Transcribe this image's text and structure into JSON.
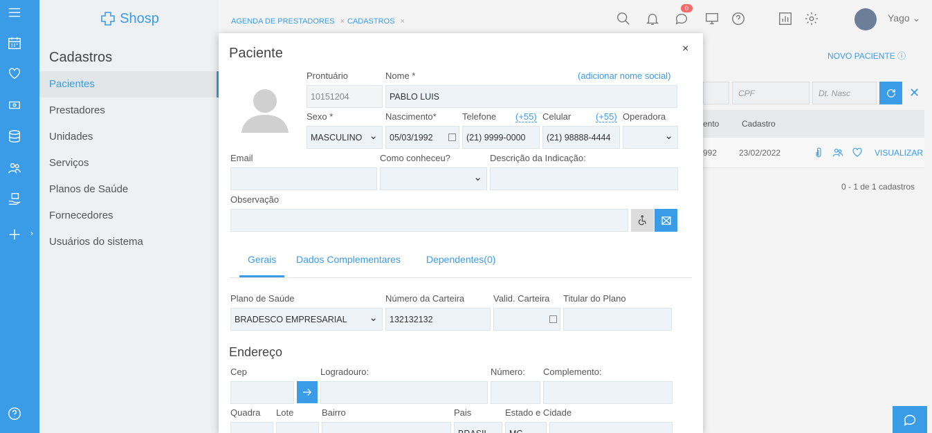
{
  "app": {
    "logo_text": "Shosp"
  },
  "sidebar": {
    "title": "Cadastros",
    "items": [
      {
        "label": "Pacientes"
      },
      {
        "label": "Prestadores"
      },
      {
        "label": "Unidades"
      },
      {
        "label": "Serviços"
      },
      {
        "label": "Planos de Saúde"
      },
      {
        "label": "Fornecedores"
      },
      {
        "label": "Usuários do sistema"
      }
    ]
  },
  "topbar": {
    "tabs": [
      {
        "label": "AGENDA DE PRESTADORES"
      },
      {
        "label": "CADASTROS"
      }
    ],
    "tab_close": "×",
    "notification_count": "0",
    "user_name": "Yago"
  },
  "background_page": {
    "novo_paciente": "NOVO PACIENTE",
    "filter_cpf_placeholder": "CPF",
    "filter_dtnasc_placeholder": "Dt. Nasc",
    "columns": [
      "ento",
      "Cadastro"
    ],
    "row": {
      "nascimento_partial": "992",
      "cadastro": "23/02/2022",
      "action": "VISUALIZAR"
    },
    "count_text": "0 - 1 de 1 cadastros"
  },
  "modal": {
    "title": "Paciente",
    "close": "×",
    "labels": {
      "prontuario": "Prontuário",
      "nome": "Nome *",
      "nome_social_link": "(adicionar nome social)",
      "sexo": "Sexo *",
      "nascimento": "Nascimento*",
      "telefone": "Telefone",
      "ddi_tel": "(+55)",
      "celular": "Celular",
      "ddi_cel": "(+55)",
      "operadora": "Operadora",
      "email": "Email",
      "como_conheceu": "Como conheceu?",
      "descricao_indicacao": "Descrição da Indicação:",
      "observacao": "Observação"
    },
    "values": {
      "prontuario": "10151204",
      "nome": "PABLO LUIS",
      "sexo": "MASCULINO",
      "nascimento": "05/03/1992",
      "telefone": "(21) 9999-0000",
      "celular": "(21) 98888-4444"
    },
    "tabs": [
      {
        "label": "Gerais"
      },
      {
        "label": "Dados Complementares"
      },
      {
        "label": "Dependentes(0)"
      }
    ],
    "plano": {
      "labels": {
        "plano": "Plano de Saúde",
        "numero": "Número da Carteira",
        "validade": "Valid. Carteira",
        "titular": "Titular do Plano"
      },
      "values": {
        "plano": "BRADESCO EMPRESARIAL",
        "numero": "132132132"
      }
    },
    "endereco": {
      "title": "Endereço",
      "labels": {
        "cep": "Cep",
        "logradouro": "Logradouro:",
        "numero": "Número:",
        "complemento": "Complemento:",
        "quadra": "Quadra",
        "lote": "Lote",
        "bairro": "Bairro",
        "pais": "Pais",
        "estado_cidade": "Estado e Cidade"
      },
      "values": {
        "pais": "BRASIL",
        "estado": "MG"
      }
    }
  },
  "colors": {
    "accent": "#3a9be6",
    "badge": "#f26a6a"
  }
}
